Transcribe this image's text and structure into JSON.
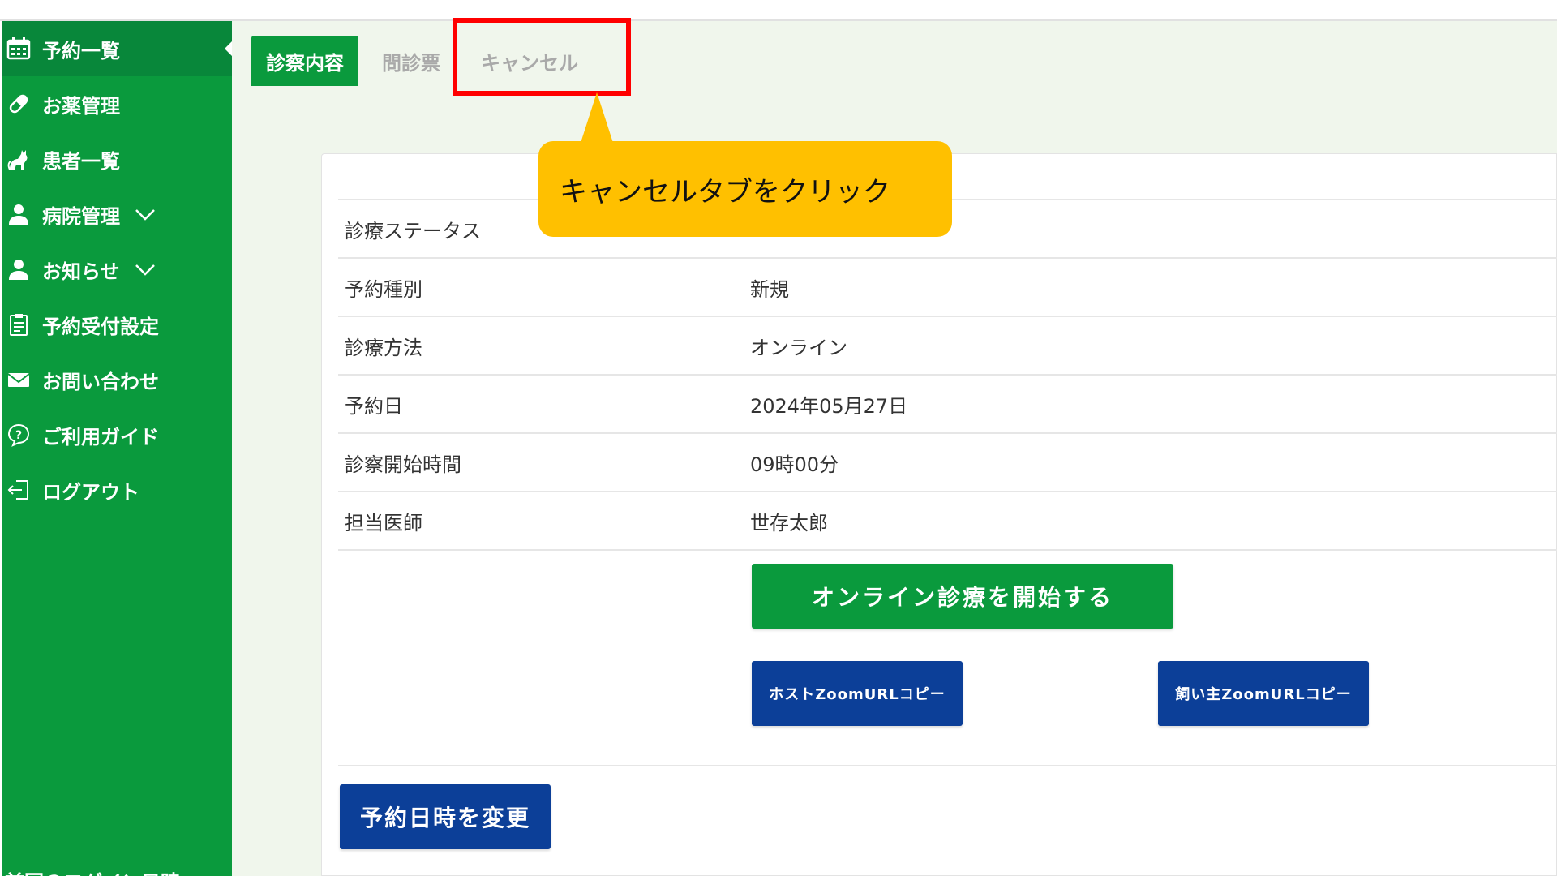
{
  "sidebar": {
    "items": [
      {
        "label": "予約一覧",
        "icon": "calendar-icon"
      },
      {
        "label": "お薬管理",
        "icon": "pill-icon"
      },
      {
        "label": "患者一覧",
        "icon": "cat-icon"
      },
      {
        "label": "病院管理",
        "icon": "person-icon"
      },
      {
        "label": "お知らせ",
        "icon": "person-icon"
      },
      {
        "label": "予約受付設定",
        "icon": "clipboard-icon"
      },
      {
        "label": "お問い合わせ",
        "icon": "mail-icon"
      },
      {
        "label": "ご利用ガイド",
        "icon": "question-bubble-icon"
      },
      {
        "label": "ログアウト",
        "icon": "logout-icon"
      }
    ],
    "last_login_label": "前回のログイン日時"
  },
  "tabs": [
    {
      "label": "診察内容",
      "active": true
    },
    {
      "label": "問診票",
      "active": false
    },
    {
      "label": "キャンセル",
      "active": false
    }
  ],
  "details": [
    {
      "label": "診療ステータス",
      "value": ""
    },
    {
      "label": "予約種別",
      "value": "新規"
    },
    {
      "label": "診療方法",
      "value": "オンライン"
    },
    {
      "label": "予約日",
      "value": "2024年05月27日"
    },
    {
      "label": "診察開始時間",
      "value": "09時00分"
    },
    {
      "label": "担当医師",
      "value": "世存太郎"
    }
  ],
  "buttons": {
    "start_online": "オンライン診療を開始する",
    "host_zoom": "ホストZoomURLコピー",
    "owner_zoom": "飼い主ZoomURLコピー",
    "change_datetime": "予約日時を変更"
  },
  "annotation": {
    "callout_text": "キャンセルタブをクリック"
  },
  "colors": {
    "sidebar_green": "#0a9a3d",
    "button_blue": "#0c3f98",
    "callout_yellow": "#ffc000",
    "highlight_red": "#ff0000"
  }
}
